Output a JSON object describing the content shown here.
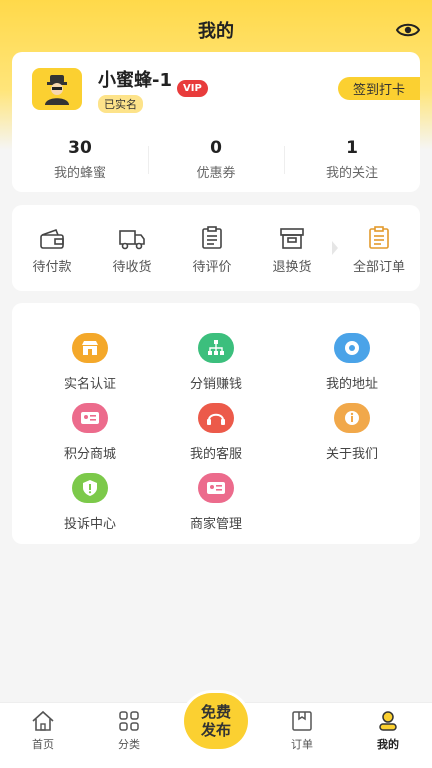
{
  "header": {
    "title": "我的"
  },
  "profile": {
    "username": "小蜜蜂-1",
    "realname_badge": "已实名",
    "vip_badge": "VIP",
    "checkin_label": "签到打卡",
    "stats": [
      {
        "value": "30",
        "label": "我的蜂蜜"
      },
      {
        "value": "0",
        "label": "优惠券"
      },
      {
        "value": "1",
        "label": "我的关注"
      }
    ]
  },
  "orders": {
    "items": [
      {
        "label": "待付款",
        "icon": "wallet-icon"
      },
      {
        "label": "待收货",
        "icon": "truck-icon"
      },
      {
        "label": "待评价",
        "icon": "review-icon"
      },
      {
        "label": "退换货",
        "icon": "return-box-icon"
      }
    ],
    "all_label": "全部订单"
  },
  "services": [
    {
      "label": "实名认证",
      "icon": "shop-icon",
      "color": "#f4a82a"
    },
    {
      "label": "分销赚钱",
      "icon": "network-icon",
      "color": "#3cbf7d"
    },
    {
      "label": "我的地址",
      "icon": "location-icon",
      "color": "#4aa3e8"
    },
    {
      "label": "积分商城",
      "icon": "id-card-icon",
      "color": "#ec6b8c"
    },
    {
      "label": "我的客服",
      "icon": "headset-icon",
      "color": "#ec5a4a"
    },
    {
      "label": "关于我们",
      "icon": "info-icon",
      "color": "#f1a84a"
    },
    {
      "label": "投诉中心",
      "icon": "alert-shield-icon",
      "color": "#7cc94a"
    },
    {
      "label": "商家管理",
      "icon": "merchant-card-icon",
      "color": "#ec6b8c"
    }
  ],
  "bottom_nav": {
    "home": "首页",
    "category": "分类",
    "publish_line1": "免费",
    "publish_line2": "发布",
    "orders": "订单",
    "mine": "我的"
  },
  "colors": {
    "accent": "#fbd031",
    "vip": "#e83c3c"
  }
}
